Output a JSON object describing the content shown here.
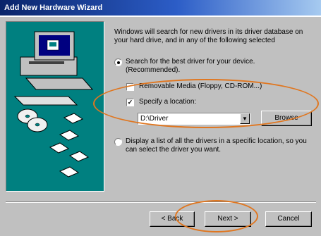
{
  "window": {
    "title": "Add New Hardware Wizard"
  },
  "intro": {
    "text": "Windows will search for new drivers in its driver database on your hard drive, and in any of the following selected"
  },
  "options": {
    "search_best": {
      "label": "Search for the best driver for your device. (Recommended).",
      "selected": true
    },
    "removable_media": {
      "label": "Removable Media (Floppy, CD-ROM...)",
      "checked": false
    },
    "specify_location": {
      "label": "Specify a location:",
      "checked": true
    },
    "location_value": "D:\\Driver",
    "display_list": {
      "label": "Display a list of all the drivers in a specific location, so you can select the driver you want.",
      "selected": false
    }
  },
  "buttons": {
    "browse": "Browse",
    "back": "< Back",
    "next": "Next >",
    "cancel": "Cancel"
  },
  "colors": {
    "title_start": "#0a246a",
    "title_end": "#a6caf0",
    "illustration_bg": "#008080",
    "annotation": "#e0761f"
  },
  "illustration": {
    "icons": [
      "computer-icon",
      "cd-icon",
      "floppy-disk-icon"
    ]
  }
}
